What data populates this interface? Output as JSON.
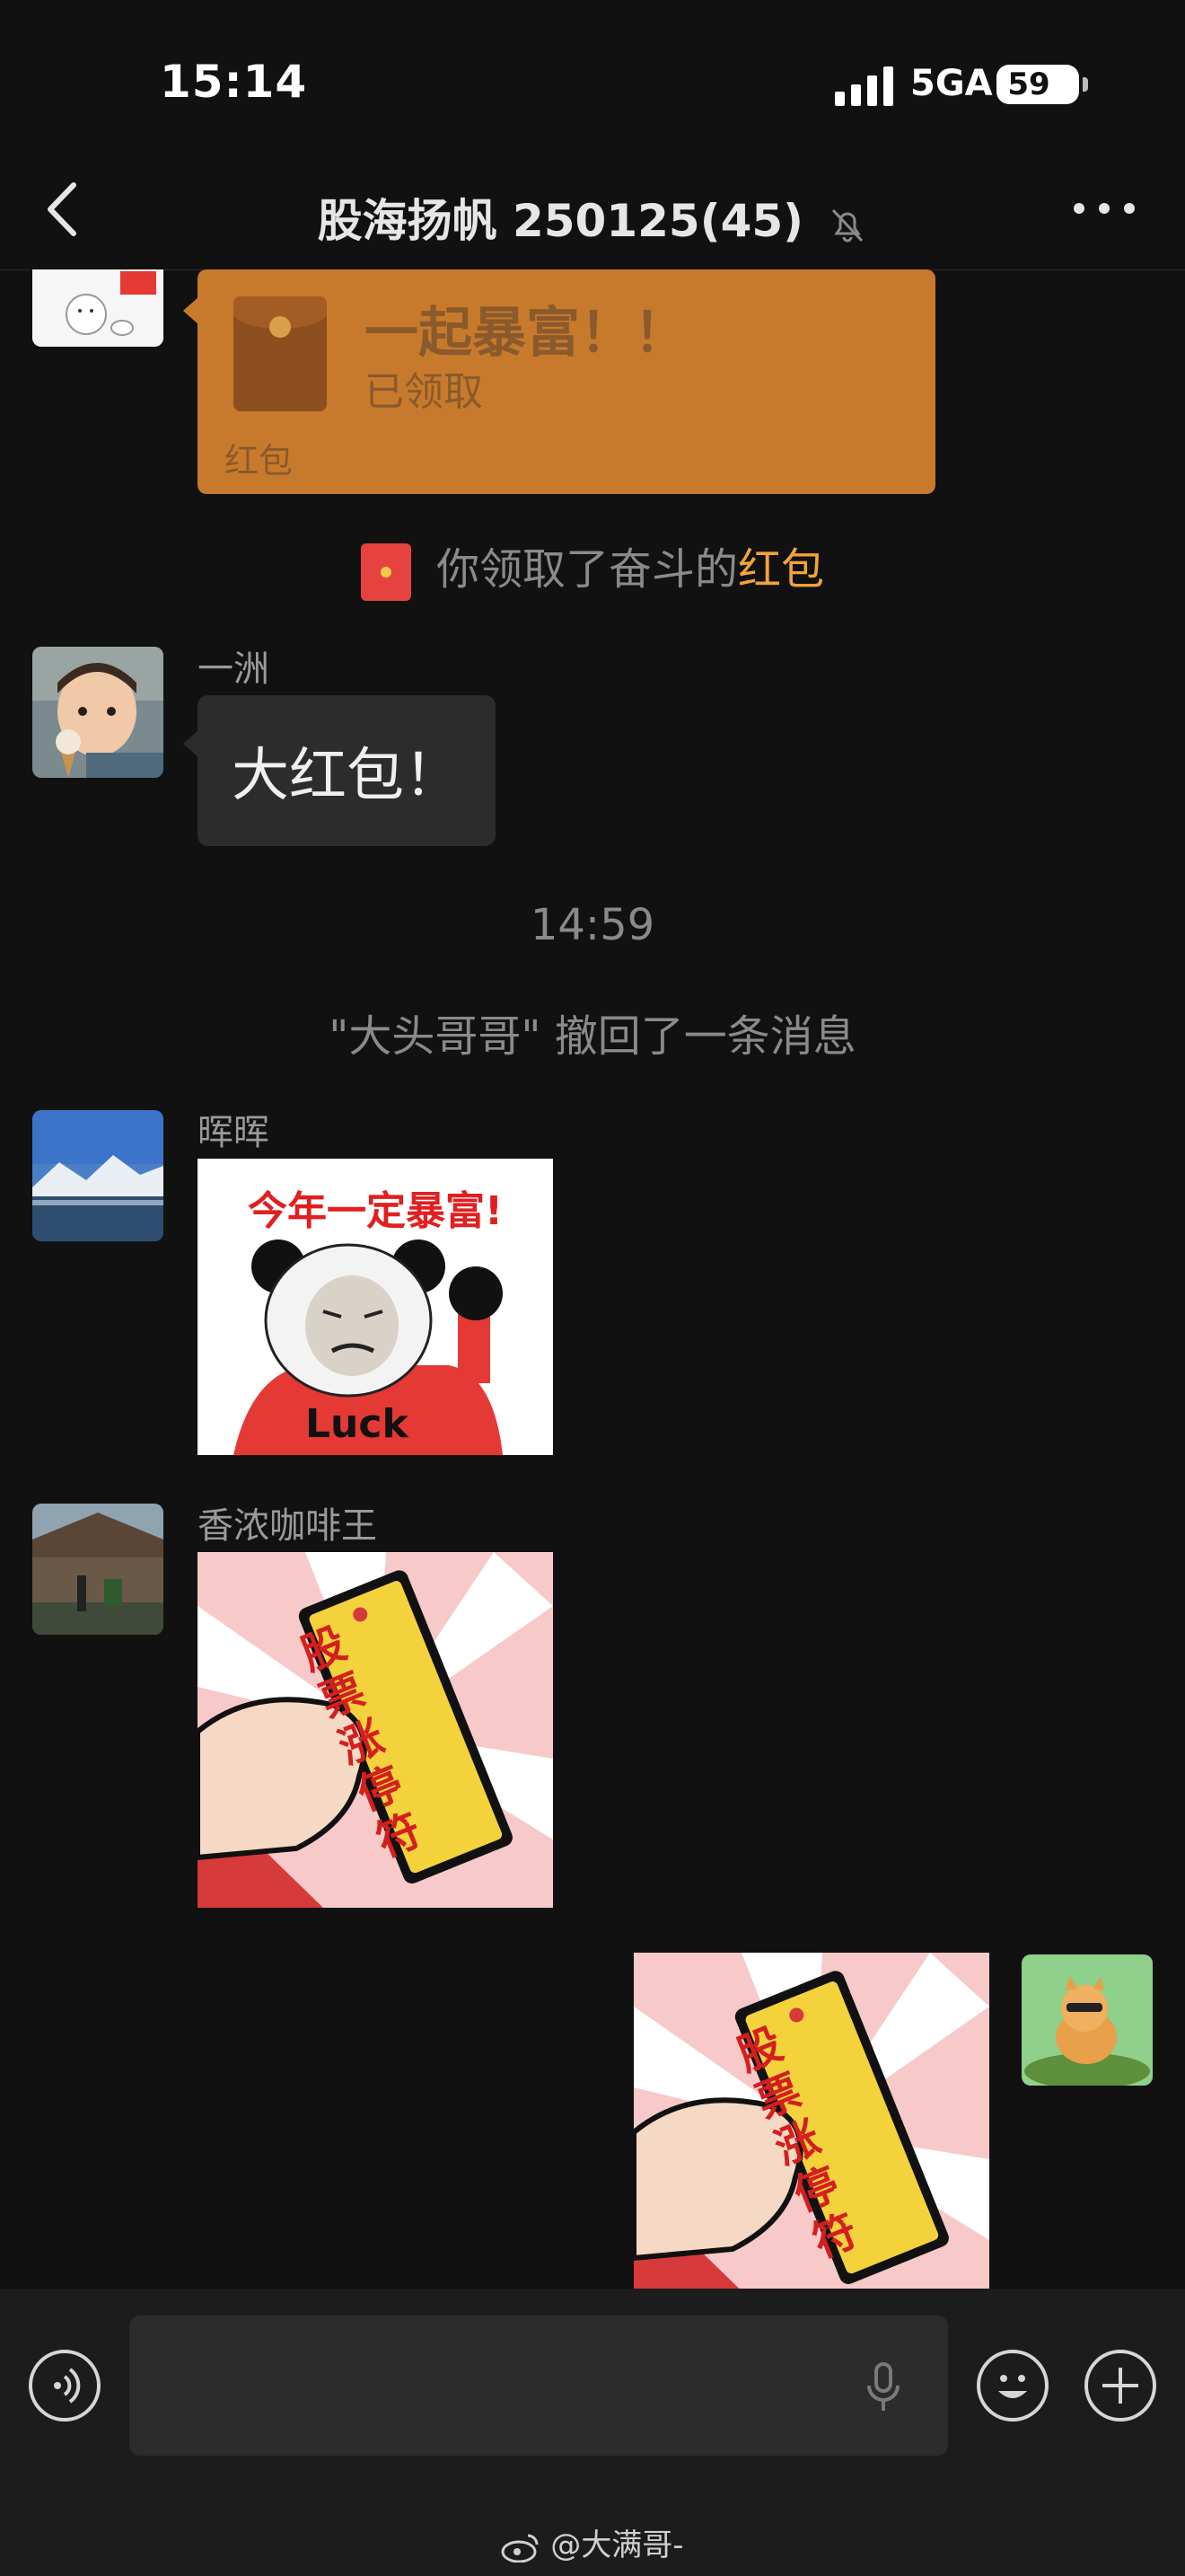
{
  "status_bar": {
    "time": "15:14",
    "network": "5GA",
    "battery": "59"
  },
  "header": {
    "title": "股海扬帆 250125",
    "member_count": "(45)"
  },
  "messages": {
    "red_packet": {
      "title": "一起暴富！！",
      "status": "已领取",
      "label": "红包"
    },
    "received_notice": {
      "prefix": "你领取了奋斗的",
      "link": "红包"
    },
    "yizhou": {
      "sender": "一洲",
      "text": "大红包！"
    },
    "timestamp": "14:59",
    "recall_notice": "\"大头哥哥\" 撤回了一条消息",
    "huihui": {
      "sender": "晖晖",
      "sticker_caption": "今年一定暴富!",
      "sticker_shirt": "Luck"
    },
    "coffee_king": {
      "sender": "香浓咖啡王",
      "sticker_text": "股票涨停符"
    },
    "self": {
      "sticker_text": "股票涨停符"
    }
  },
  "watermark": "@大满哥-",
  "colors": {
    "background": "#111111",
    "red_packet": "#c87a2c",
    "highlight": "#f2a33a",
    "bubble": "#2c2c2c"
  }
}
